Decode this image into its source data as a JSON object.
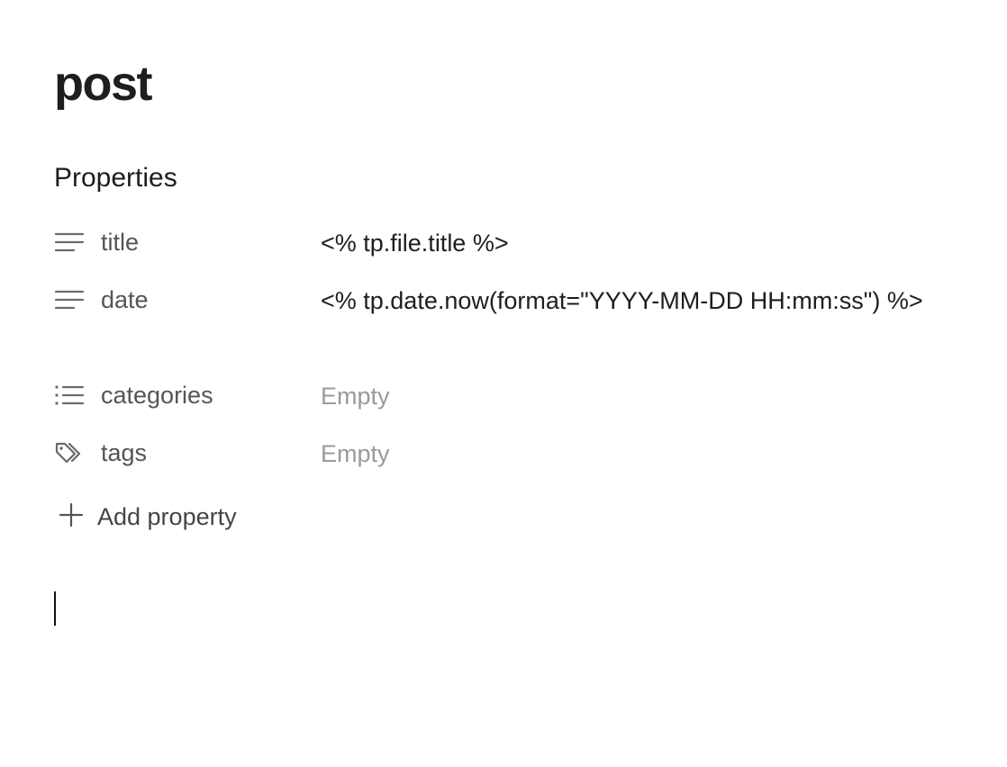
{
  "note": {
    "title": "post"
  },
  "properties": {
    "heading": "Properties",
    "items": [
      {
        "icon": "text-lines-icon",
        "name": "title",
        "value": "<% tp.file.title %>",
        "empty": false
      },
      {
        "icon": "text-lines-icon",
        "name": "date",
        "value": "<% tp.date.now(format=\"YYYY-MM-DD HH:mm:ss\") %>",
        "empty": false
      },
      {
        "icon": "list-icon",
        "name": "categories",
        "value": "Empty",
        "empty": true
      },
      {
        "icon": "tags-icon",
        "name": "tags",
        "value": "Empty",
        "empty": true
      }
    ],
    "add_label": "Add property"
  },
  "colors": {
    "text": "#1e1e1e",
    "muted": "#555555",
    "placeholder": "#9a9a9a",
    "background": "#ffffff"
  }
}
